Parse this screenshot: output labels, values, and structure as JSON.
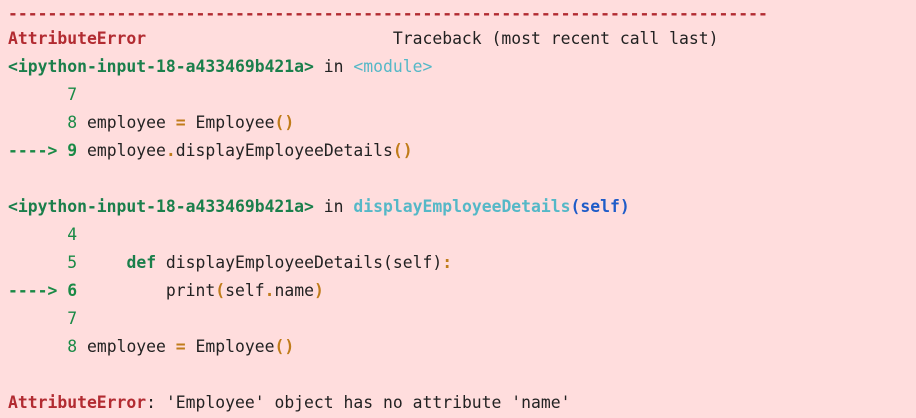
{
  "separator": "-----------------------------------------------------------------------------",
  "header": {
    "error_type": "AttributeError",
    "traceback_label": "Traceback (most recent call last)"
  },
  "frames": [
    {
      "file": "<ipython-input-18-a433469b421a>",
      "in_word": "in",
      "location": "<module>",
      "lines": [
        {
          "marker": "      ",
          "num": "7",
          "code": ""
        },
        {
          "marker": "      ",
          "num": "8",
          "code_parts": [
            "employee ",
            "=",
            " Employee",
            "()"
          ]
        },
        {
          "marker": "----> ",
          "num": "9",
          "code_parts": [
            "employee",
            ".",
            "displayEmployeeDetails",
            "()"
          ]
        }
      ]
    },
    {
      "file": "<ipython-input-18-a433469b421a>",
      "in_word": "in",
      "location": "displayEmployeeDetails",
      "location_args": "(self)",
      "lines": [
        {
          "marker": "      ",
          "num": "4",
          "code": ""
        },
        {
          "marker": "      ",
          "num": "5",
          "code_parts": [
            "    ",
            "def",
            " displayEmployeeDetails(self)",
            ":"
          ]
        },
        {
          "marker": "----> ",
          "num": "6",
          "code_parts": [
            "        print",
            "(",
            "self",
            ".",
            "name",
            ")"
          ]
        },
        {
          "marker": "      ",
          "num": "7",
          "code": ""
        },
        {
          "marker": "      ",
          "num": "8",
          "code_parts": [
            "employee ",
            "=",
            " Employee",
            "()"
          ]
        }
      ]
    }
  ],
  "footer": {
    "error_type": "AttributeError",
    "colon": ":",
    "message": " 'Employee' object has no attribute 'name'"
  },
  "colors": {
    "background": "#ffdddd",
    "error_red": "#b22b31",
    "green": "#1a7f4b",
    "cyan": "#55b8c7",
    "blue": "#1f5cc8",
    "operator": "#c07c1a"
  }
}
